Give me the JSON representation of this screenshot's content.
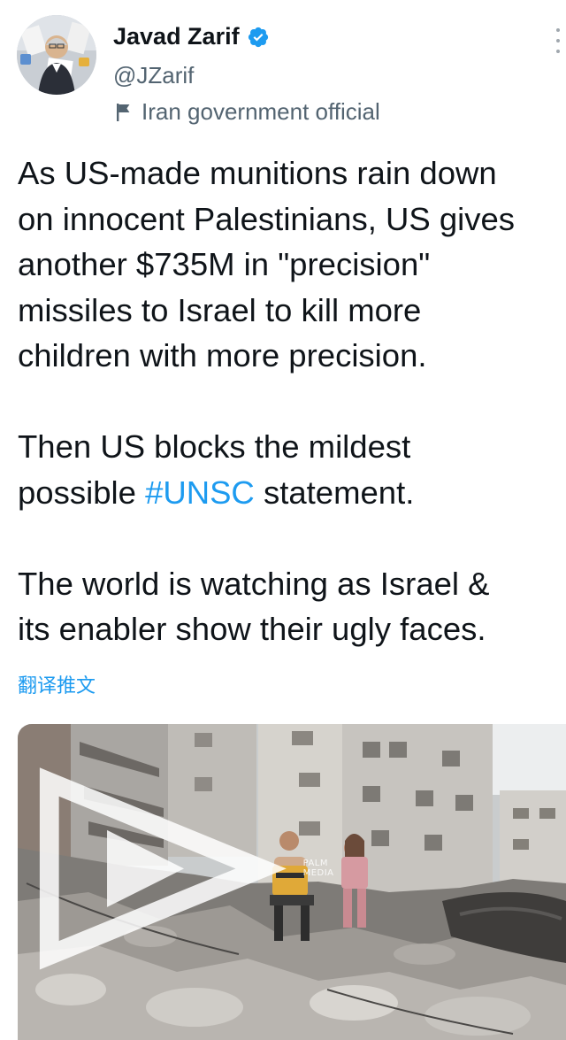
{
  "author": {
    "display_name": "Javad Zarif",
    "handle": "@JZarif",
    "label": "Iran government official",
    "verified": true
  },
  "tweet": {
    "lines": [
      "As US-made munitions rain down",
      "on innocent Palestinians, US gives",
      "another $735M in \"precision\"",
      "missiles to Israel to kill more",
      "children with more precision."
    ],
    "para2_line1": "Then US blocks the mildest",
    "para2_line2_prefix": "possible ",
    "hashtag": "#UNSC",
    "para2_line2_suffix": " statement.",
    "para3_line1": "The world is watching as Israel &",
    "para3_line2": "its enabler show their ugly faces."
  },
  "translate_label": "翻译推文",
  "media": {
    "watermark_line1": "PALM",
    "watermark_line2": "MEDIA"
  },
  "colors": {
    "accent": "#1d9bf0",
    "text": "#0f1419",
    "secondary": "#536471"
  },
  "icons": [
    "verified-badge-icon",
    "flag-icon",
    "more-options-icon",
    "palm-media-logo-icon"
  ]
}
